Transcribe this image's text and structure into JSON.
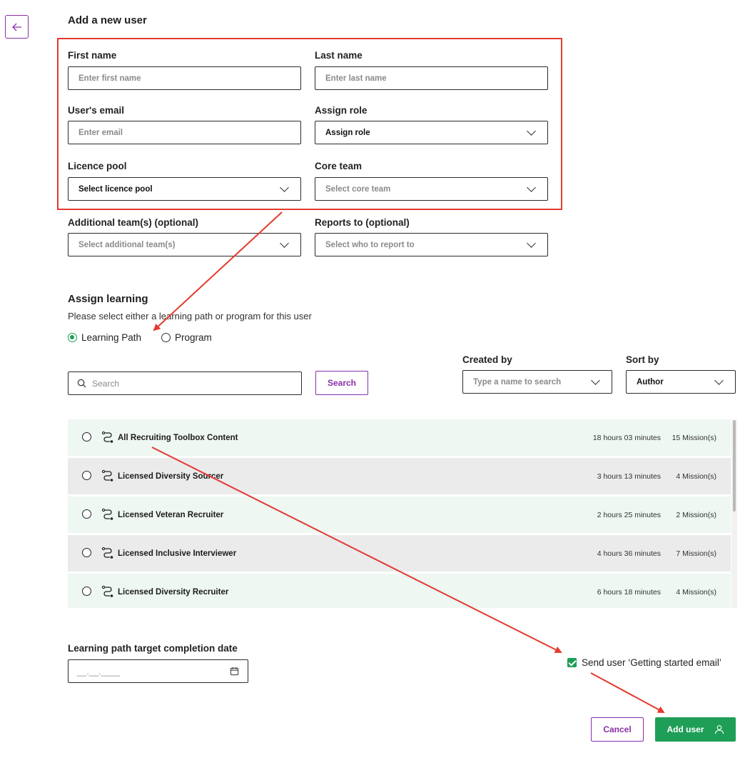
{
  "page": {
    "title": "Add a new user"
  },
  "form": {
    "first_name": {
      "label": "First name",
      "placeholder": "Enter first name"
    },
    "last_name": {
      "label": "Last name",
      "placeholder": "Enter last name"
    },
    "email": {
      "label": "User's email",
      "placeholder": "Enter email"
    },
    "role": {
      "label": "Assign role",
      "value": "Assign role"
    },
    "licence_pool": {
      "label": "Licence pool",
      "value": "Select licence pool"
    },
    "core_team": {
      "label": "Core team",
      "placeholder": "Select core team"
    },
    "additional_teams": {
      "label": "Additional team(s) (optional)",
      "placeholder": "Select additional team(s)"
    },
    "reports_to": {
      "label": "Reports to (optional)",
      "placeholder": "Select who to report to"
    }
  },
  "learning": {
    "title": "Assign learning",
    "subtitle": "Please select either a learning path or program for this user",
    "options": [
      {
        "label": "Learning Path",
        "selected": true
      },
      {
        "label": "Program",
        "selected": false
      }
    ],
    "search_placeholder": "Search",
    "search_button": "Search",
    "created_by": {
      "label": "Created by",
      "placeholder": "Type a name to search"
    },
    "sort_by": {
      "label": "Sort by",
      "value": "Author"
    },
    "items": [
      {
        "name": "All Recruiting Toolbox Content",
        "duration": "18 hours 03 minutes",
        "missions": "15 Mission(s)"
      },
      {
        "name": "Licensed Diversity Sourcer",
        "duration": "3 hours 13 minutes",
        "missions": "4 Mission(s)"
      },
      {
        "name": "Licensed Veteran Recruiter",
        "duration": "2 hours 25 minutes",
        "missions": "2 Mission(s)"
      },
      {
        "name": "Licensed Inclusive Interviewer",
        "duration": "4 hours 36 minutes",
        "missions": "7 Mission(s)"
      },
      {
        "name": "Licensed Diversity Recruiter",
        "duration": "6 hours 18 minutes",
        "missions": "4 Mission(s)"
      }
    ]
  },
  "completion": {
    "label": "Learning path target completion date",
    "placeholder": "__.__.____"
  },
  "email_option": {
    "label": "Send user ‘Getting started email’",
    "checked": true
  },
  "actions": {
    "cancel": "Cancel",
    "add_user": "Add user"
  },
  "icons": {
    "back": "arrow-left-icon",
    "search": "search-icon",
    "path": "learning-path-icon",
    "calendar": "calendar-icon",
    "user": "user-icon",
    "chevron": "chevron-down-icon"
  },
  "colors": {
    "accent_purple": "#8a2fa6",
    "success_green": "#1e9e57",
    "annotation_red": "#e23b2e",
    "row_green": "#eef7f1",
    "row_gray": "#ebebeb"
  }
}
